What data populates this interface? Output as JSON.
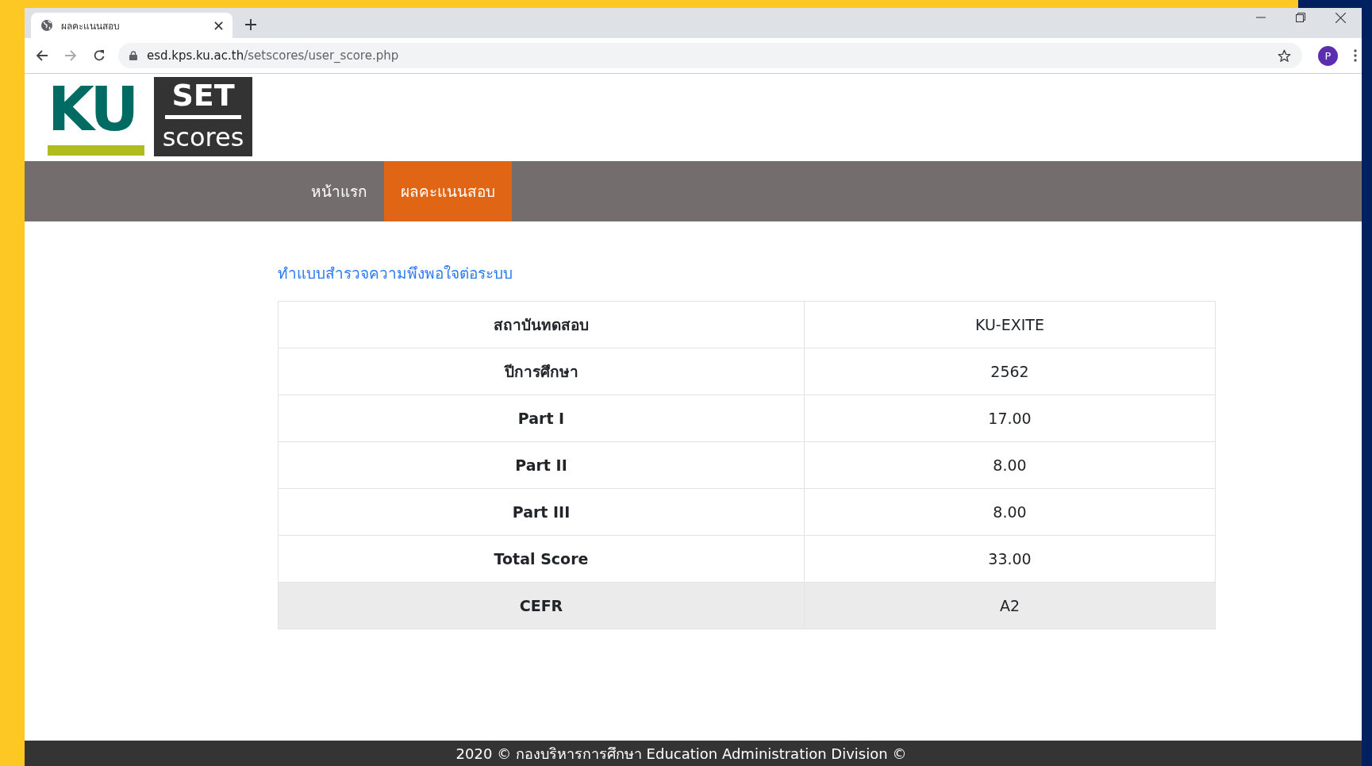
{
  "browser": {
    "tab": {
      "title": "ผลคะแนนสอบ"
    },
    "address_bar": {
      "domain": "esd.kps.ku.ac.th",
      "path": "/setscores/user_score.php"
    },
    "profile": {
      "initial": "P"
    }
  },
  "logo": {
    "mark": "KU",
    "word_top": "SET",
    "word_bottom": "scores"
  },
  "nav": [
    {
      "label": "หน้าแรก",
      "selected": false
    },
    {
      "label": "ผลคะแนนสอบ",
      "selected": true
    }
  ],
  "survey_link": "ทำแบบสำรวจความพึงพอใจต่อระบบ",
  "score_table": [
    {
      "label": "สถาบันทดสอบ",
      "value": "KU-EXITE",
      "highlighted": false
    },
    {
      "label": "ปีการศึกษา",
      "value": "2562",
      "highlighted": false
    },
    {
      "label": "Part I",
      "value": "17.00",
      "highlighted": false
    },
    {
      "label": "Part II",
      "value": "8.00",
      "highlighted": false
    },
    {
      "label": "Part III",
      "value": "8.00",
      "highlighted": false
    },
    {
      "label": "Total Score",
      "value": "33.00",
      "highlighted": false
    },
    {
      "label": "CEFR",
      "value": "A2",
      "highlighted": true
    }
  ],
  "footer": "2020 © กองบริหารการศึกษา Education Administration Division ©"
}
